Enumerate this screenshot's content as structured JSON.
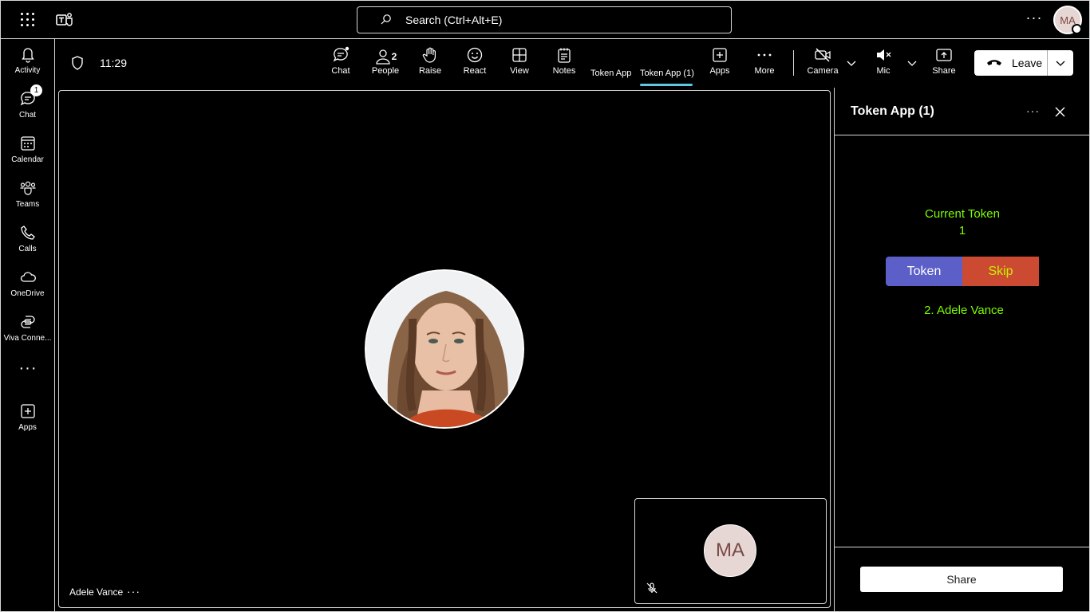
{
  "topbar": {
    "search_placeholder": "Search (Ctrl+Alt+E)",
    "more_label": "···",
    "user_initials": "MA",
    "icons": [
      "app-launcher-icon",
      "teams-logo-icon",
      "search-icon",
      "more-icon"
    ]
  },
  "rail": {
    "items": [
      {
        "label": "Activity",
        "icon": "bell-icon"
      },
      {
        "label": "Chat",
        "icon": "chat-icon",
        "badge": "1"
      },
      {
        "label": "Calendar",
        "icon": "calendar-icon"
      },
      {
        "label": "Teams",
        "icon": "teams-icon"
      },
      {
        "label": "Calls",
        "icon": "phone-icon"
      },
      {
        "label": "OneDrive",
        "icon": "cloud-icon"
      },
      {
        "label": "Viva Conne...",
        "icon": "viva-connections-icon"
      }
    ],
    "more_label": "···",
    "apps_label": "Apps"
  },
  "meeting": {
    "time": "11:29",
    "toolbar": {
      "chat": "Chat",
      "people": "People",
      "people_count": "2",
      "raise": "Raise",
      "react": "React",
      "view": "View",
      "notes": "Notes",
      "token_app": "Token App",
      "token_app_1": "Token App (1)",
      "apps": "Apps",
      "more": "More",
      "camera": "Camera",
      "mic": "Mic",
      "share": "Share",
      "leave": "Leave"
    },
    "participant_name": "Adele Vance",
    "self_initials": "MA",
    "accent_color": "#5fc8e6"
  },
  "panel": {
    "title": "Token App (1)",
    "current_token_label": "Current Token",
    "current_token_value": "1",
    "token_button": "Token",
    "skip_button": "Skip",
    "queue": [
      "2. Adele Vance"
    ],
    "share_button": "Share",
    "colors": {
      "token_text": "#7cfc00",
      "token_button": "#5b5fc7",
      "skip_button": "#cc4a31",
      "skip_text": "#c8f000"
    }
  }
}
